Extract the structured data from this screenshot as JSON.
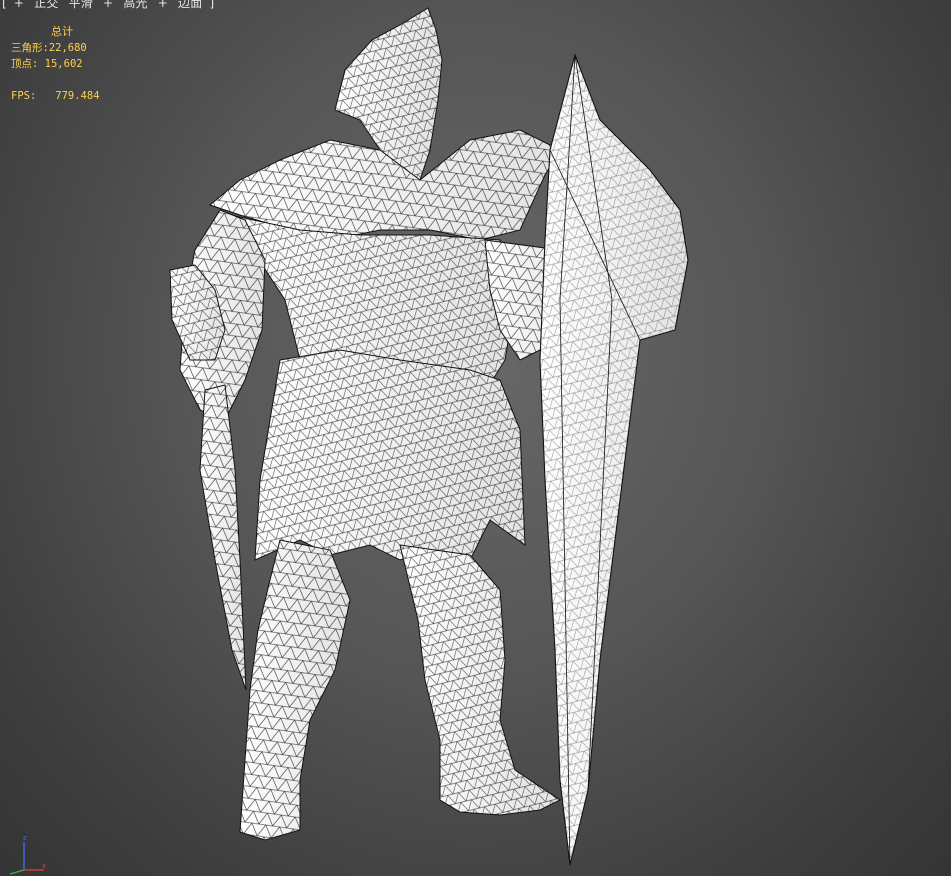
{
  "viewport": {
    "menu": [
      "[",
      "+",
      "正交",
      "平滑",
      "+",
      "高光",
      "+",
      "边面",
      "]"
    ]
  },
  "stats": {
    "header": "总计",
    "triangles_label": "三角形:",
    "triangles_value": "22,680",
    "vertices_label": "顶点:",
    "vertices_value": "15,602",
    "fps_label": "FPS:",
    "fps_value": "779.484"
  },
  "gizmo": {
    "z": "z",
    "x": "x"
  },
  "colors": {
    "background": "#555555",
    "stats_text": "#ffd24a",
    "mesh_fill": "#f2f2f2",
    "wire": "#111111",
    "axis_x": "#d23a3a",
    "axis_y": "#3ab04a",
    "axis_z": "#3a6fe0"
  }
}
